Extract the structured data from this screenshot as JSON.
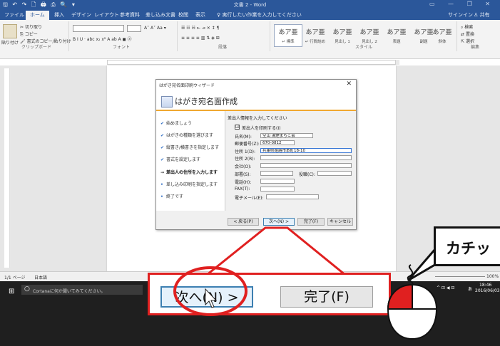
{
  "window": {
    "title": "文書 2 - Word",
    "qat": "🖫 ↶ ↷ 🗋 🖨 ⎙ 🔍 ▾",
    "controls": "▭ — ❐ ✕"
  },
  "tabs": [
    "ファイル",
    "ホーム",
    "挿入",
    "デザイン",
    "レイアウト",
    "参考資料",
    "差し込み文書",
    "校閲",
    "表示"
  ],
  "tell_me": "♀ 実行したい作業を入力してください",
  "account": {
    "signin": "サインイン",
    "share": "共有"
  },
  "ribbon": {
    "clipboard": {
      "paste": "貼り付け",
      "cut": "切り取り",
      "copy": "コピー",
      "format_painter": "書式のコピー/貼り付け",
      "label": "クリップボード"
    },
    "font": {
      "label": "フォント",
      "format_row": "B  I  U  ·  abc  x₂  x²  A  ab  A  ◼  ⓐ"
    },
    "paragraph": {
      "label": "段落",
      "row1": "☰  ☷  ☵  ⇤  ⇥  ✕  ↕  ¶",
      "row2": "≡  ≡  ≡  ≡  ▥  ⇅  ◈  ⊞"
    },
    "styles": {
      "label": "スタイル",
      "items": [
        {
          "sample": "あア亜",
          "name": "↵ 標準"
        },
        {
          "sample": "あア亜",
          "name": "↵ 行間詰め"
        },
        {
          "sample": "あア亜",
          "name": "見出し 1"
        },
        {
          "sample": "あア亜",
          "name": "見出し 2"
        },
        {
          "sample": "あア亜",
          "name": "表題"
        },
        {
          "sample": "あア亜",
          "name": "副題"
        },
        {
          "sample": "あア亜",
          "name": "斜体"
        }
      ]
    },
    "editing": {
      "find": "検索",
      "replace": "置換",
      "select": "選択",
      "label": "編集"
    }
  },
  "status": {
    "page": "1/1 ページ",
    "lang": "日本語",
    "zoom": "100%"
  },
  "taskbar": {
    "cortana": "Cortanaに何か聞いてみてください。",
    "time": "18:46",
    "date": "2016/06/03",
    "ime": "あ"
  },
  "dialog": {
    "title": "はがき宛名面印刷ウィザード",
    "heading": "はがき宛名面作成",
    "steps": [
      {
        "mark": "✔",
        "label": "始めましょう",
        "state": "done"
      },
      {
        "mark": "✔",
        "label": "はがきの種類を選びます",
        "state": "done"
      },
      {
        "mark": "✔",
        "label": "縦書き/横書きを指定します",
        "state": "done"
      },
      {
        "mark": "✔",
        "label": "書式を設定します",
        "state": "done"
      },
      {
        "mark": "→",
        "label": "差出人の住所を入力します",
        "state": "current"
      },
      {
        "mark": "•",
        "label": "差し込み印刷を指定します",
        "state": "todo"
      },
      {
        "mark": "•",
        "label": "終了です",
        "state": "todo"
      }
    ],
    "instruction": "差出人情報を入力してください",
    "print_sender": {
      "label": "差出人を印刷する(I)",
      "checked": "☑"
    },
    "fields": {
      "name": {
        "label": "氏名(M):",
        "value": "空山 湯煙まちこ会"
      },
      "zip": {
        "label": "郵便番号(Z):",
        "value": "670-0812"
      },
      "addr1": {
        "label": "住所 1(D):",
        "value": "兵庫県姫路市本町18-10"
      },
      "addr2": {
        "label": "住所 2(R):",
        "value": ""
      },
      "company": {
        "label": "会社(O):",
        "value": ""
      },
      "dept": {
        "label": "部署(S):",
        "value": ""
      },
      "title": {
        "label": "役職(C):",
        "value": ""
      },
      "phone": {
        "label": "電話(H):",
        "value": ""
      },
      "fax": {
        "label": "FAX(T):",
        "value": ""
      },
      "email": {
        "label": "電子メール(E):",
        "value": ""
      }
    },
    "buttons": {
      "back": "< 戻る(P)",
      "next": "次へ(N) >",
      "finish": "完了(F)",
      "cancel": "キャンセル"
    }
  },
  "zoom_callout": {
    "next": "次へ(N) >",
    "finish": "完了(F)"
  },
  "speech": {
    "text": "カチッ"
  },
  "colors": {
    "word_blue": "#2b579a",
    "accent_orange": "#f0a830",
    "highlight_red": "#e02020"
  }
}
